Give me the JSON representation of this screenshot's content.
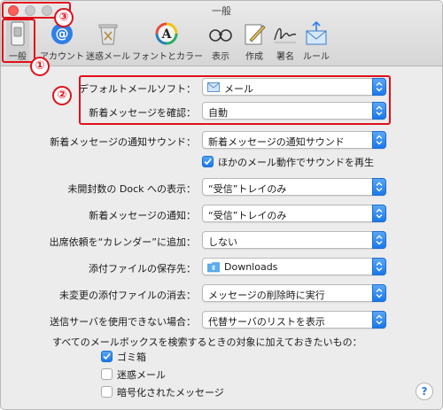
{
  "window": {
    "title": "一般"
  },
  "toolbar": {
    "items": [
      {
        "label": "一般"
      },
      {
        "label": "アカウント"
      },
      {
        "label": "迷惑メール"
      },
      {
        "label": "フォントとカラー"
      },
      {
        "label": "表示"
      },
      {
        "label": "作成"
      },
      {
        "label": "署名"
      },
      {
        "label": "ルール"
      }
    ]
  },
  "annotations": {
    "n1": "①",
    "n2": "②",
    "n3": "③"
  },
  "settings": {
    "default_mail": {
      "label": "デフォルトメールソフト：",
      "value": "メール"
    },
    "check_new": {
      "label": "新着メッセージを確認：",
      "value": "自動"
    },
    "sound": {
      "label": "新着メッセージの通知サウンド：",
      "value": "新着メッセージの通知サウンド"
    },
    "play_other": {
      "label": "ほかのメール動作でサウンドを再生",
      "checked": true
    },
    "dock_unread": {
      "label": "未開封数の Dock への表示：",
      "value": "“受信”トレイのみ"
    },
    "notify": {
      "label": "新着メッセージの通知：",
      "value": "“受信”トレイのみ"
    },
    "calendar": {
      "label": "出席依頼を“カレンダー”に追加：",
      "value": "しない"
    },
    "save_attachments": {
      "label": "添付ファイルの保存先：",
      "value": "Downloads"
    },
    "remove_attachments": {
      "label": "未変更の添付ファイルの消去：",
      "value": "メッセージの削除時に実行"
    },
    "outgoing": {
      "label": "送信サーバを使用できない場合：",
      "value": "代替サーバのリストを表示"
    }
  },
  "search_section": {
    "heading": "すべてのメールボックスを検索するときの対象に加えておきたいもの：",
    "options": [
      {
        "label": "ゴミ箱",
        "checked": true
      },
      {
        "label": "迷惑メール",
        "checked": false
      },
      {
        "label": "暗号化されたメッセージ",
        "checked": false
      }
    ]
  },
  "help": {
    "label": "?"
  },
  "colors": {
    "annotation_red": "#e0101a",
    "accent_blue": "#1a78ea"
  }
}
